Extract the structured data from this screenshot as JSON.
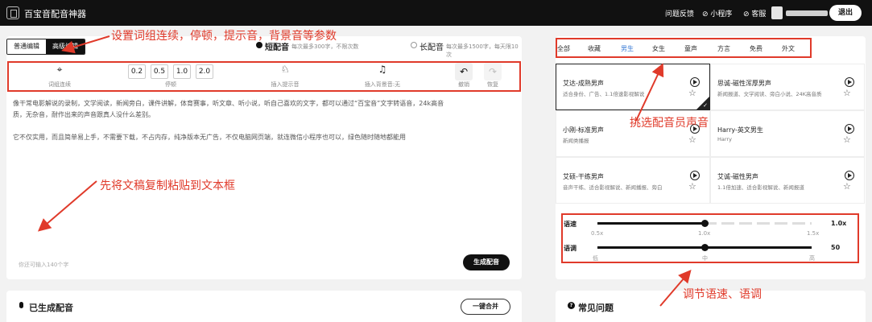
{
  "header": {
    "app_title": "百宝音配音神器",
    "links": [
      "问题反馈",
      "小程序",
      "客服"
    ],
    "logout_label": "退出"
  },
  "editor": {
    "mode_tabs": [
      "普通编辑",
      "高级编辑"
    ],
    "active_mode_tab": 1,
    "short_dub": {
      "label": "短配音",
      "sub": "每次最多300字，不限次数"
    },
    "long_dub": {
      "label": "长配音",
      "sub": "每次最多1500字，每天限10次"
    },
    "toolbar": {
      "phrase_link_label": "词组连续",
      "pause_values": [
        "0.2",
        "0.5",
        "1.0",
        "2.0"
      ],
      "pause_label": "停顿",
      "hint_label": "插入提示音",
      "bgm_label": "插入背景音:无",
      "undo_label": "撤销",
      "redo_label": "恢复"
    },
    "text_lines": [
      "像干常电影解说的录制，文学阅读，新闻旁白，课件讲解，体育赛事，听文章、听小说，听自己喜欢的文字，都可以通过“百宝音”文字转语音，24k高音",
      "质，无杂音，耐作出来的声音跟真人没什么差别。",
      "",
      "它不仅实用，而且简单易上手，不需要下载，不占内存，纯净版本无广告，不仅电脑网页端，就连微信小程序也可以，绿色随时随地都能用"
    ],
    "char_count": "你还可输入140个字",
    "generate_label": "生成配音"
  },
  "voices": {
    "tabs": [
      "全部",
      "收藏",
      "男生",
      "女生",
      "童声",
      "方言",
      "免费",
      "外文"
    ],
    "active_tab": 2,
    "cards": [
      {
        "name": "艾达-成熟男声",
        "desc": "适合身份、广告、1.1倍速影视解说",
        "selected": true
      },
      {
        "name": "思诚-磁性浑厚男声",
        "desc": "新闻报道、文学阅读、旁白小说、24K高音质",
        "selected": false
      },
      {
        "name": "小刚-标准男声",
        "desc": "新闻类播报",
        "selected": false
      },
      {
        "name": "Harry-英文男生",
        "desc": "Harry",
        "selected": false
      },
      {
        "name": "艾硕-干练男声",
        "desc": "音声干练、适合影视解说、新闻播报、旁白",
        "selected": false
      },
      {
        "name": "艾诚-磁性男声",
        "desc": "1.1倍加速、适合影视解说、新闻报道",
        "selected": false
      }
    ]
  },
  "sliders": {
    "speed": {
      "label": "语速",
      "value_text": "1.0x",
      "level": 0.5,
      "ticks": [
        "0.5x",
        "1.0x",
        "1.5x"
      ]
    },
    "pitch": {
      "label": "语调",
      "value_text": "50",
      "level": 0.5,
      "ticks": [
        "低",
        "中",
        "高"
      ]
    }
  },
  "bottom": {
    "generated_title": "已生成配音",
    "merge_label": "一键合并",
    "faq_title": "常见问题"
  },
  "annotations": {
    "params": "设置词组连续，停顿，提示音，背景音等参数",
    "paste": "先将文稿复制粘贴到文本框",
    "pick_voice": "挑选配音员声音",
    "adjust": "调节语速、语调"
  },
  "colors": {
    "annotation": "#e03a2a",
    "accent": "#3a7bd5",
    "dark": "#111111"
  }
}
